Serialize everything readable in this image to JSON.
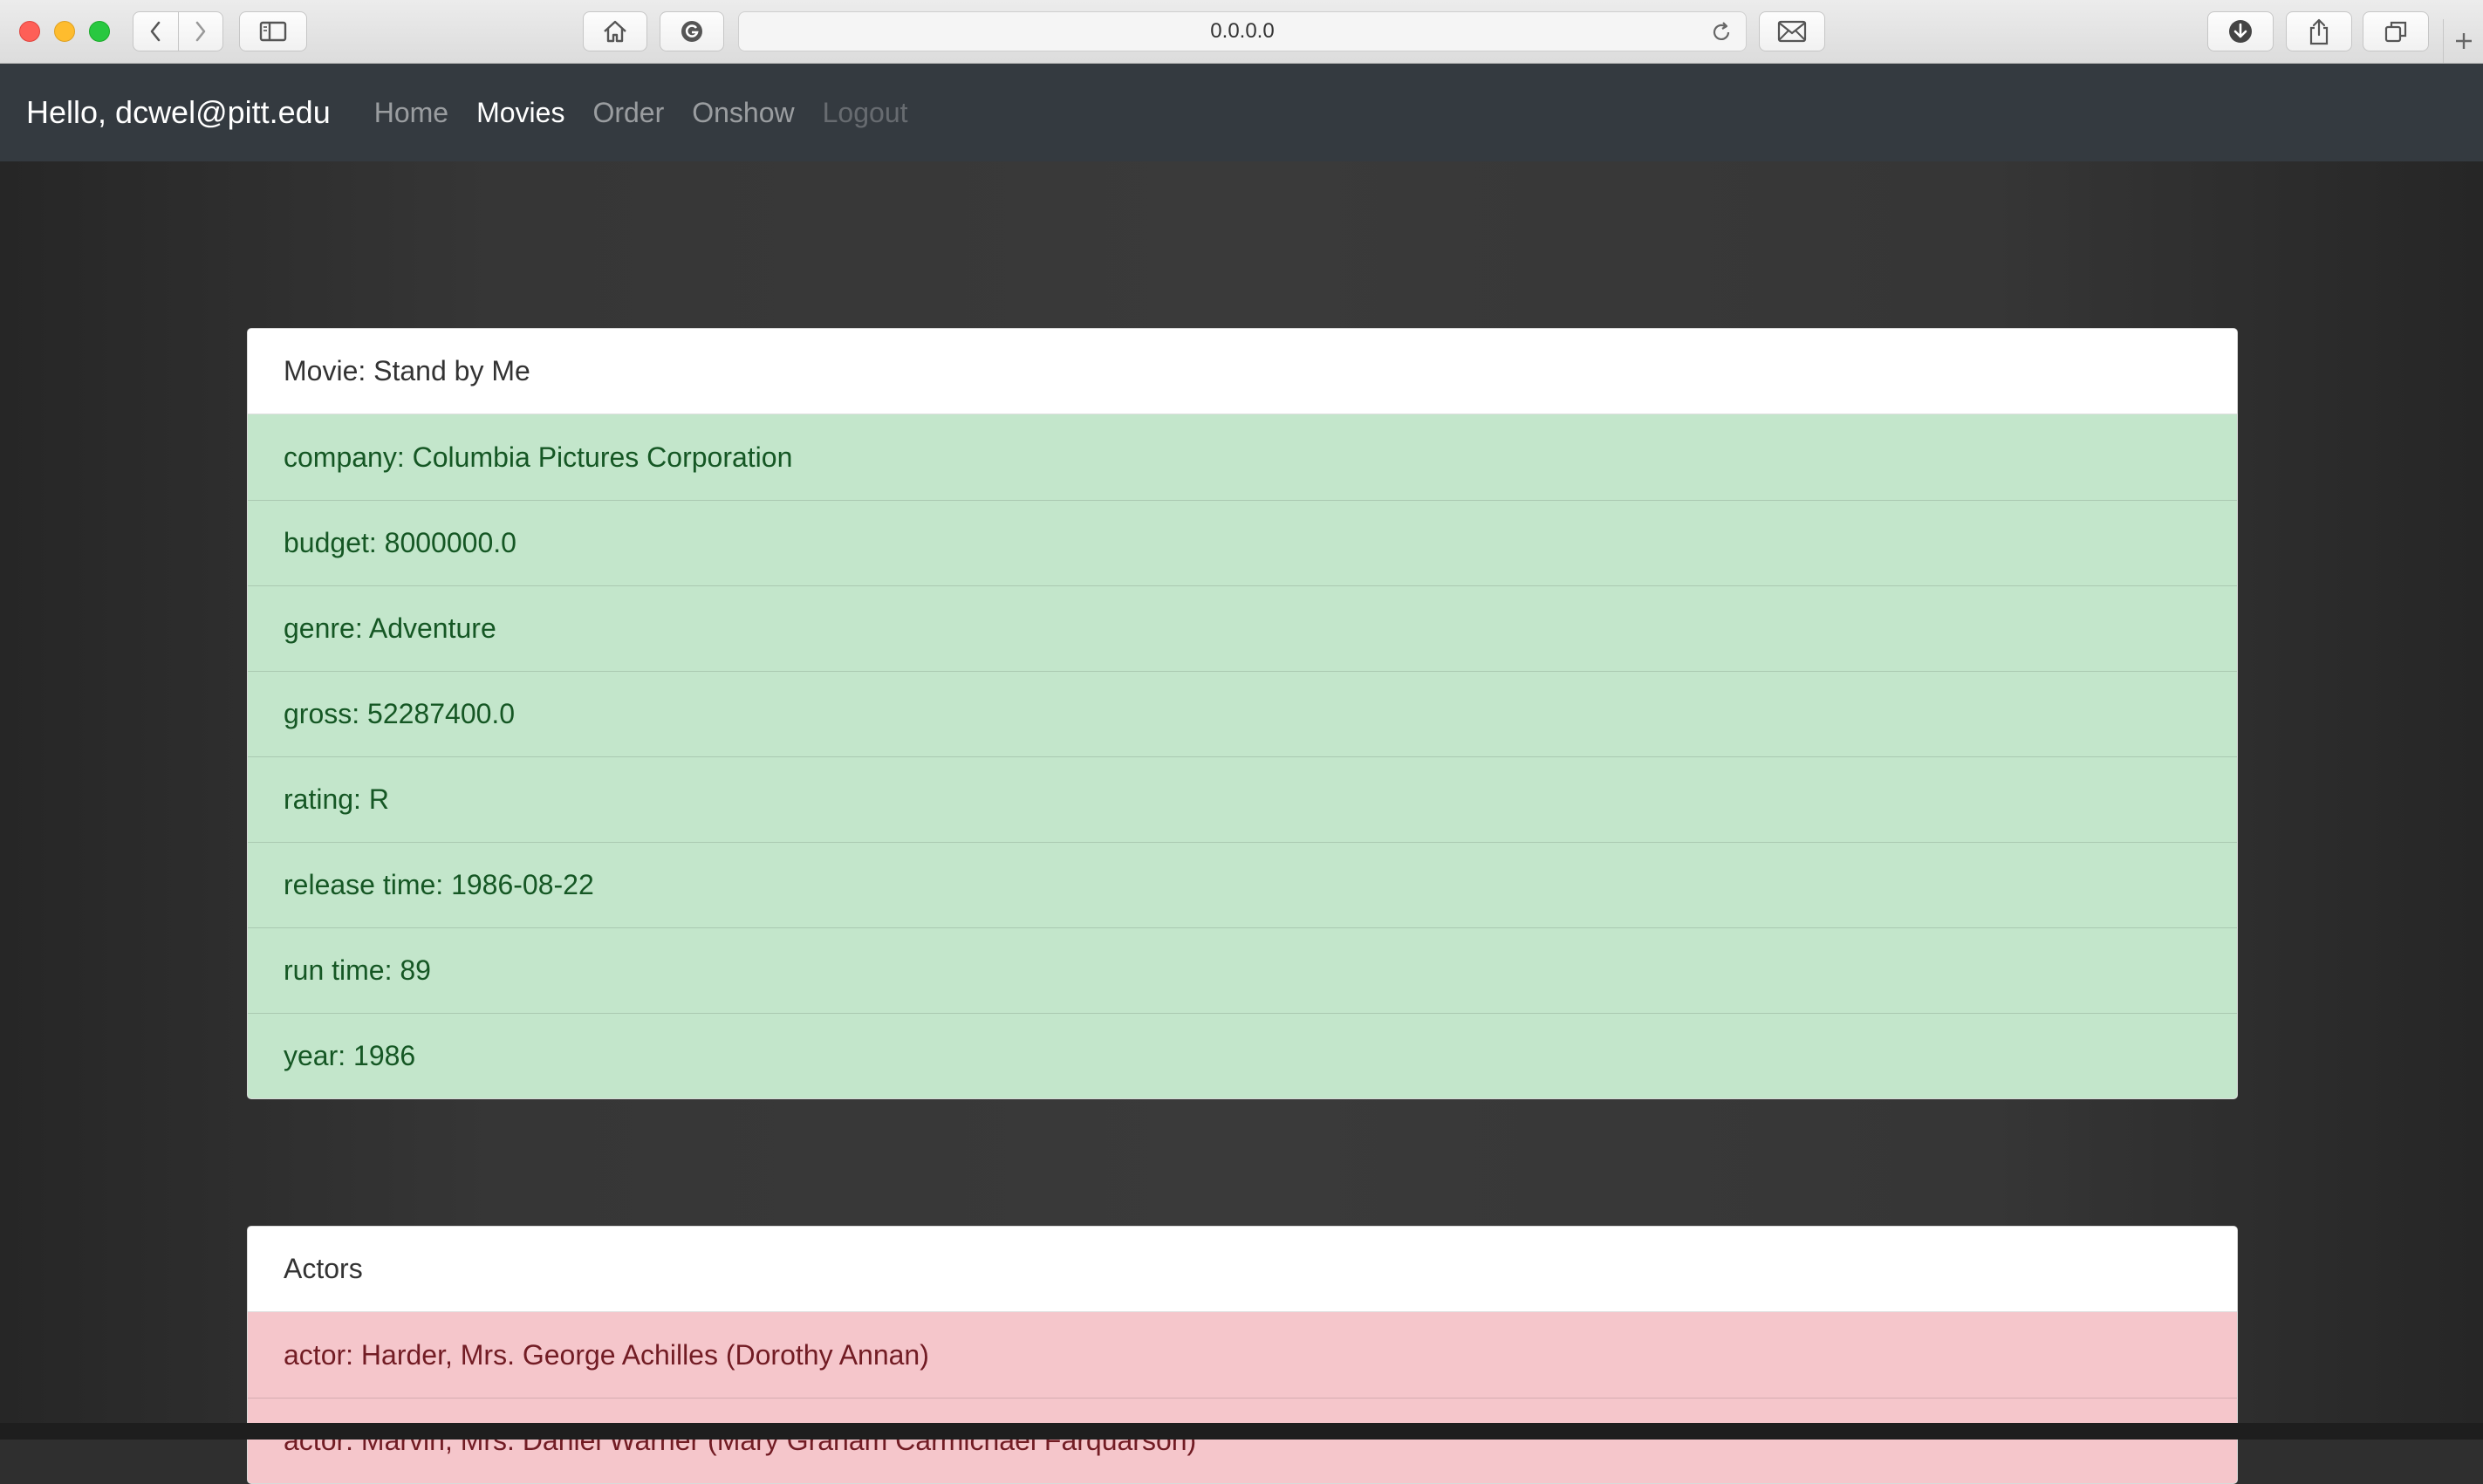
{
  "browser": {
    "url": "0.0.0.0"
  },
  "navbar": {
    "brand": "Hello, dcwel@pitt.edu",
    "links": [
      {
        "label": "Home"
      },
      {
        "label": "Movies"
      },
      {
        "label": "Order"
      },
      {
        "label": "Onshow"
      },
      {
        "label": "Logout"
      }
    ]
  },
  "movie": {
    "header": "Movie: Stand by Me",
    "fields": [
      "company: Columbia Pictures Corporation",
      "budget: 8000000.0",
      "genre: Adventure",
      "gross: 52287400.0",
      "rating: R",
      "release time: 1986-08-22",
      "run time: 89",
      "year: 1986"
    ]
  },
  "actors": {
    "header": "Actors",
    "items": [
      "actor: Harder, Mrs. George Achilles (Dorothy Annan)",
      "actor: Marvin, Mrs. Daniel Warner (Mary Graham Carmichael Farquarson)"
    ]
  }
}
